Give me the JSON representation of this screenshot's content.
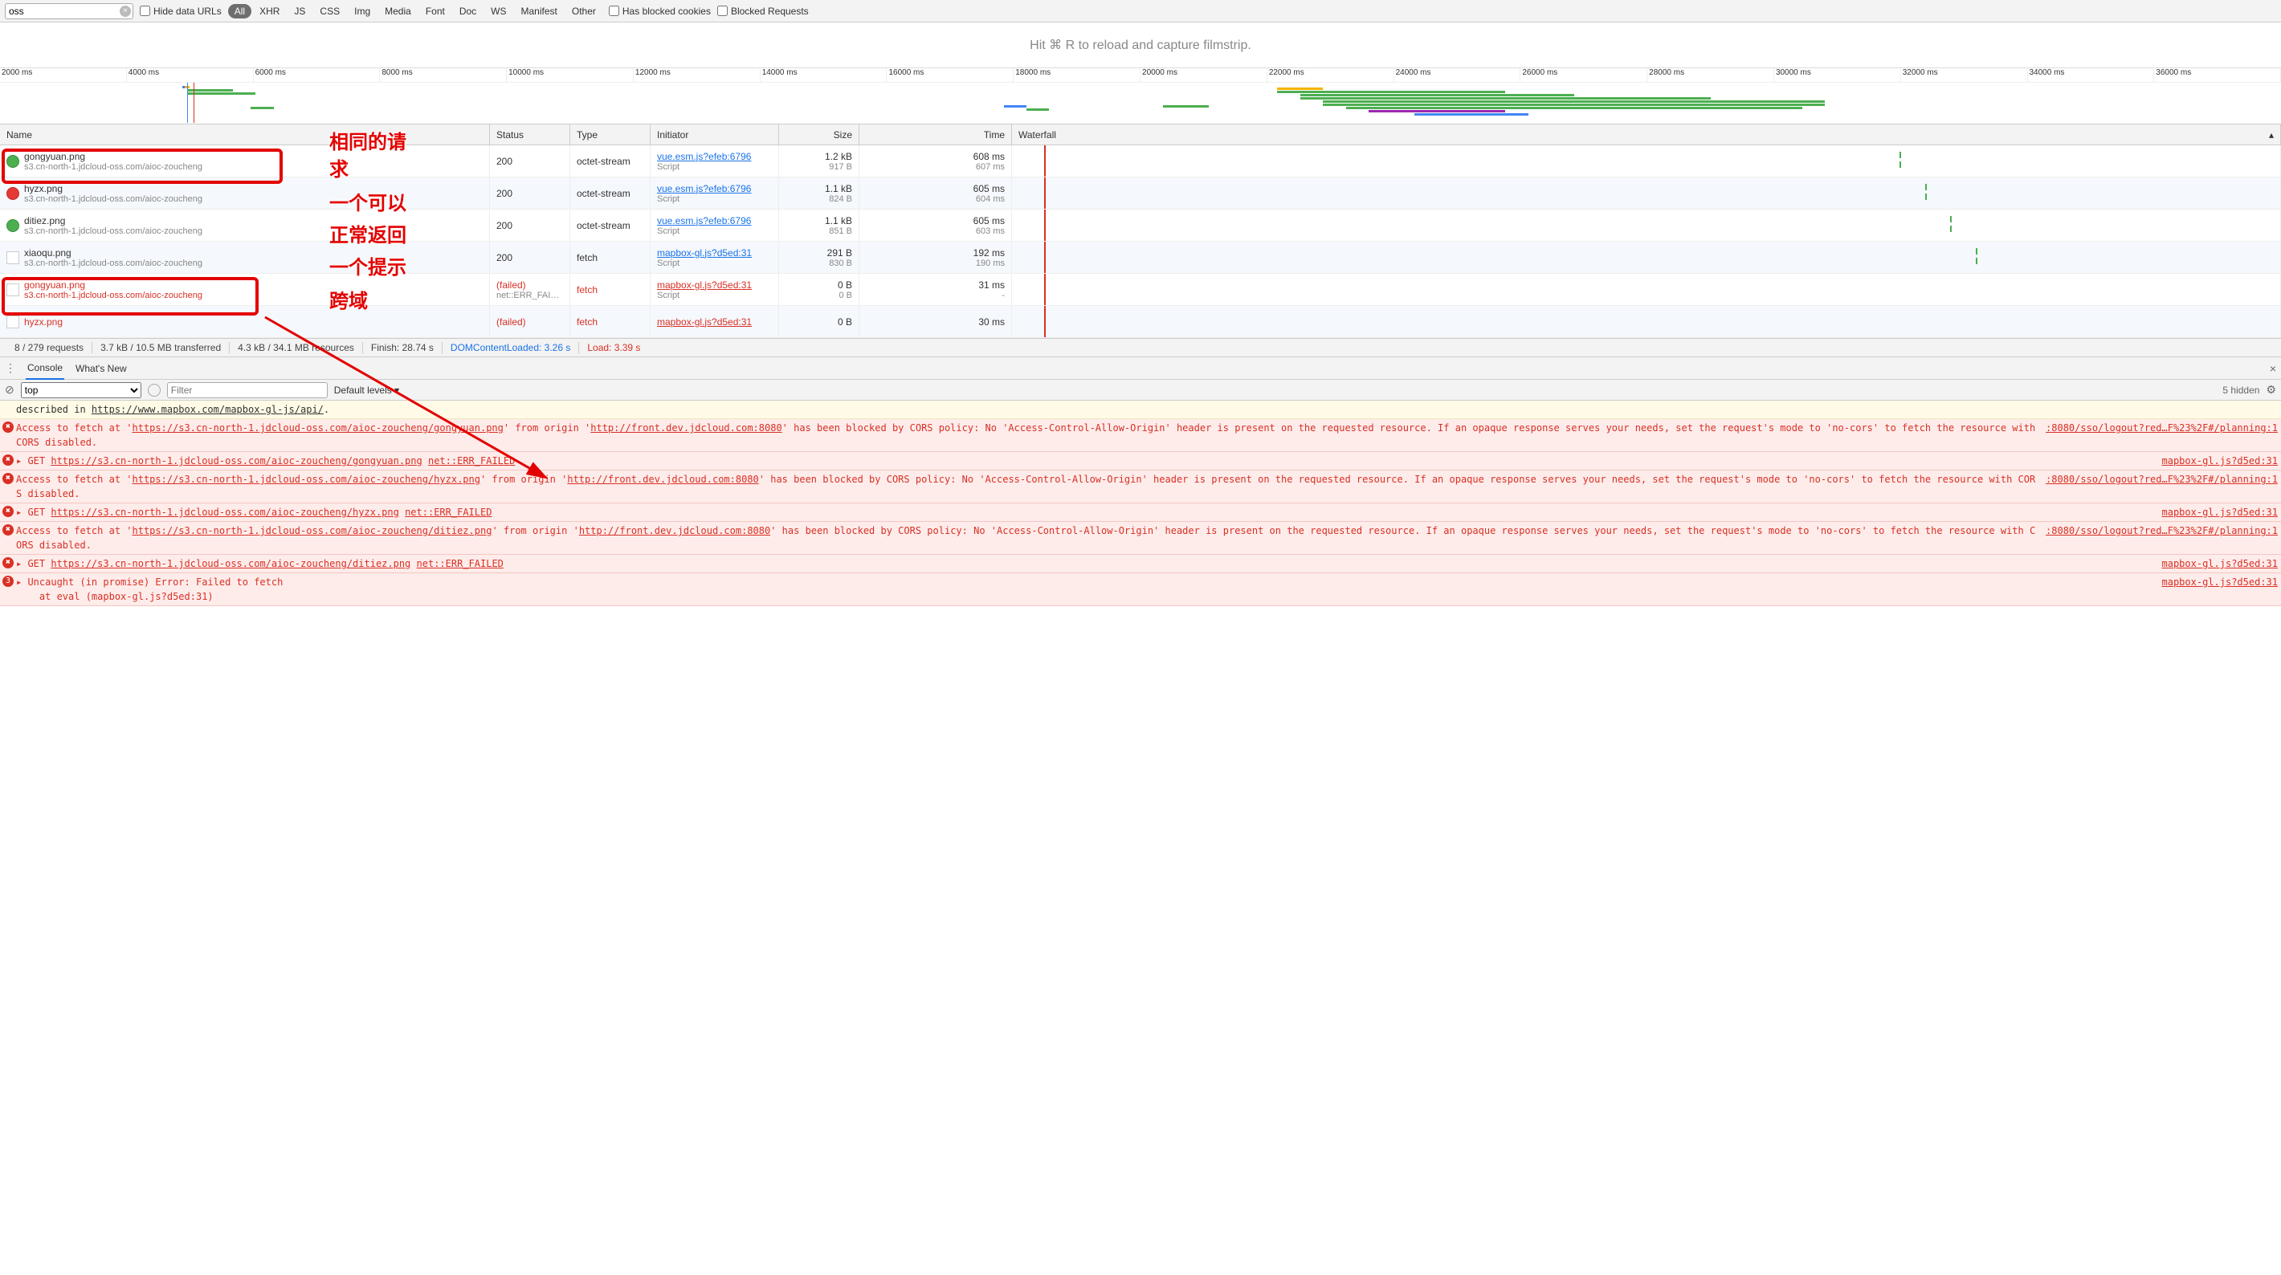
{
  "toolbar": {
    "filter_value": "oss",
    "hide_data_urls": "Hide data URLs",
    "types": [
      "All",
      "XHR",
      "JS",
      "CSS",
      "Img",
      "Media",
      "Font",
      "Doc",
      "WS",
      "Manifest",
      "Other"
    ],
    "active_type": "All",
    "has_blocked_cookies": "Has blocked cookies",
    "blocked_requests": "Blocked Requests"
  },
  "filmstrip": {
    "hint": "Hit ⌘ R to reload and capture filmstrip."
  },
  "timeline": {
    "ticks": [
      "2000 ms",
      "4000 ms",
      "6000 ms",
      "8000 ms",
      "10000 ms",
      "12000 ms",
      "14000 ms",
      "16000 ms",
      "18000 ms",
      "20000 ms",
      "22000 ms",
      "24000 ms",
      "26000 ms",
      "28000 ms",
      "30000 ms",
      "32000 ms",
      "34000 ms",
      "36000 ms"
    ]
  },
  "columns": {
    "name": "Name",
    "status": "Status",
    "type": "Type",
    "initiator": "Initiator",
    "size": "Size",
    "time": "Time",
    "waterfall": "Waterfall"
  },
  "rows": [
    {
      "icon": "green",
      "name": "gongyuan.png",
      "url": "s3.cn-north-1.jdcloud-oss.com/aioc-zoucheng",
      "status": "200",
      "type": "octet-stream",
      "initiator": "vue.esm.js?efeb:6796",
      "initiator_sub": "Script",
      "size": "1.2 kB",
      "size_sub": "917 B",
      "time": "608 ms",
      "time_sub": "607 ms",
      "failed": false
    },
    {
      "icon": "red",
      "name": "hyzx.png",
      "url": "s3.cn-north-1.jdcloud-oss.com/aioc-zoucheng",
      "status": "200",
      "type": "octet-stream",
      "initiator": "vue.esm.js?efeb:6796",
      "initiator_sub": "Script",
      "size": "1.1 kB",
      "size_sub": "824 B",
      "time": "605 ms",
      "time_sub": "604 ms",
      "failed": false
    },
    {
      "icon": "green",
      "name": "ditiez.png",
      "url": "s3.cn-north-1.jdcloud-oss.com/aioc-zoucheng",
      "status": "200",
      "type": "octet-stream",
      "initiator": "vue.esm.js?efeb:6796",
      "initiator_sub": "Script",
      "size": "1.1 kB",
      "size_sub": "851 B",
      "time": "605 ms",
      "time_sub": "603 ms",
      "failed": false
    },
    {
      "icon": "blank",
      "name": "xiaoqu.png",
      "url": "s3.cn-north-1.jdcloud-oss.com/aioc-zoucheng",
      "status": "200",
      "type": "fetch",
      "initiator": "mapbox-gl.js?d5ed:31",
      "initiator_sub": "Script",
      "size": "291 B",
      "size_sub": "830 B",
      "time": "192 ms",
      "time_sub": "190 ms",
      "failed": false
    },
    {
      "icon": "blank",
      "name": "gongyuan.png",
      "url": "s3.cn-north-1.jdcloud-oss.com/aioc-zoucheng",
      "status": "(failed)",
      "status_sub": "net::ERR_FAI…",
      "type": "fetch",
      "initiator": "mapbox-gl.js?d5ed:31",
      "initiator_sub": "Script",
      "size": "0 B",
      "size_sub": "0 B",
      "time": "31 ms",
      "time_sub": "-",
      "failed": true
    },
    {
      "icon": "blank",
      "name": "hyzx.png",
      "url": "",
      "status": "(failed)",
      "type": "fetch",
      "initiator": "mapbox-gl.js?d5ed:31",
      "initiator_sub": "",
      "size": "0 B",
      "size_sub": "",
      "time": "30 ms",
      "time_sub": "",
      "failed": true
    }
  ],
  "status_bar": {
    "requests": "8 / 279 requests",
    "transferred": "3.7 kB / 10.5 MB transferred",
    "resources": "4.3 kB / 34.1 MB resources",
    "finish": "Finish: 28.74 s",
    "dcl": "DOMContentLoaded: 3.26 s",
    "load": "Load: 3.39 s"
  },
  "drawer": {
    "tabs": [
      "Console",
      "What's New"
    ],
    "active": "Console"
  },
  "console_toolbar": {
    "context": "top",
    "filter_placeholder": "Filter",
    "levels": "Default levels ▾",
    "hidden": "5 hidden",
    "ban_icon": "⊘"
  },
  "annotations": {
    "a1": "相同的请",
    "a2": "求",
    "a3": "一个可以",
    "a4": "正常返回",
    "a5": "一个提示",
    "a6": "跨域"
  },
  "console_logs": [
    {
      "type": "info",
      "badge": "",
      "msg_pre": "described in ",
      "msg_link": "https://www.mapbox.com/mapbox-gl-js/api/",
      "msg_post": ".",
      "src": ""
    },
    {
      "type": "error",
      "badge": "err",
      "msg": "Access to fetch at 'https://s3.cn-north-1.jdcloud-oss.com/aioc-zoucheng/gongyuan.png' from origin 'http://front.dev.jdcloud.com:8080' has been blocked by CORS policy: No 'Access-Control-Allow-Origin' header is present on the requested resource. If an opaque response serves your needs, set the request's mode to 'no-cors' to fetch the resource with CORS disabled.",
      "src": ":8080/sso/logout?red…F%23%2F#/planning:1"
    },
    {
      "type": "error",
      "badge": "err",
      "arrow": true,
      "msg": "▸ GET https://s3.cn-north-1.jdcloud-oss.com/aioc-zoucheng/gongyuan.png net::ERR_FAILED",
      "src": "mapbox-gl.js?d5ed:31"
    },
    {
      "type": "error",
      "badge": "err",
      "msg": "Access to fetch at 'https://s3.cn-north-1.jdcloud-oss.com/aioc-zoucheng/hyzx.png' from origin 'http://front.dev.jdcloud.com:8080' has been blocked by CORS policy: No 'Access-Control-Allow-Origin' header is present on the requested resource. If an opaque response serves your needs, set the request's mode to 'no-cors' to fetch the resource with CORS disabled.",
      "src": ":8080/sso/logout?red…F%23%2F#/planning:1"
    },
    {
      "type": "error",
      "badge": "err",
      "arrow": true,
      "msg": "▸ GET https://s3.cn-north-1.jdcloud-oss.com/aioc-zoucheng/hyzx.png net::ERR_FAILED",
      "src": "mapbox-gl.js?d5ed:31"
    },
    {
      "type": "error",
      "badge": "err",
      "msg": "Access to fetch at 'https://s3.cn-north-1.jdcloud-oss.com/aioc-zoucheng/ditiez.png' from origin 'http://front.dev.jdcloud.com:8080' has been blocked by CORS policy: No 'Access-Control-Allow-Origin' header is present on the requested resource. If an opaque response serves your needs, set the request's mode to 'no-cors' to fetch the resource with CORS disabled.",
      "src": ":8080/sso/logout?red…F%23%2F#/planning:1"
    },
    {
      "type": "error",
      "badge": "err",
      "arrow": true,
      "msg": "▸ GET https://s3.cn-north-1.jdcloud-oss.com/aioc-zoucheng/ditiez.png net::ERR_FAILED",
      "src": "mapbox-gl.js?d5ed:31"
    },
    {
      "type": "error",
      "badge": "cnt",
      "cnt": "3",
      "msg": "▸ Uncaught (in promise) Error: Failed to fetch\n    at eval (mapbox-gl.js?d5ed:31)",
      "src": "mapbox-gl.js?d5ed:31"
    }
  ]
}
